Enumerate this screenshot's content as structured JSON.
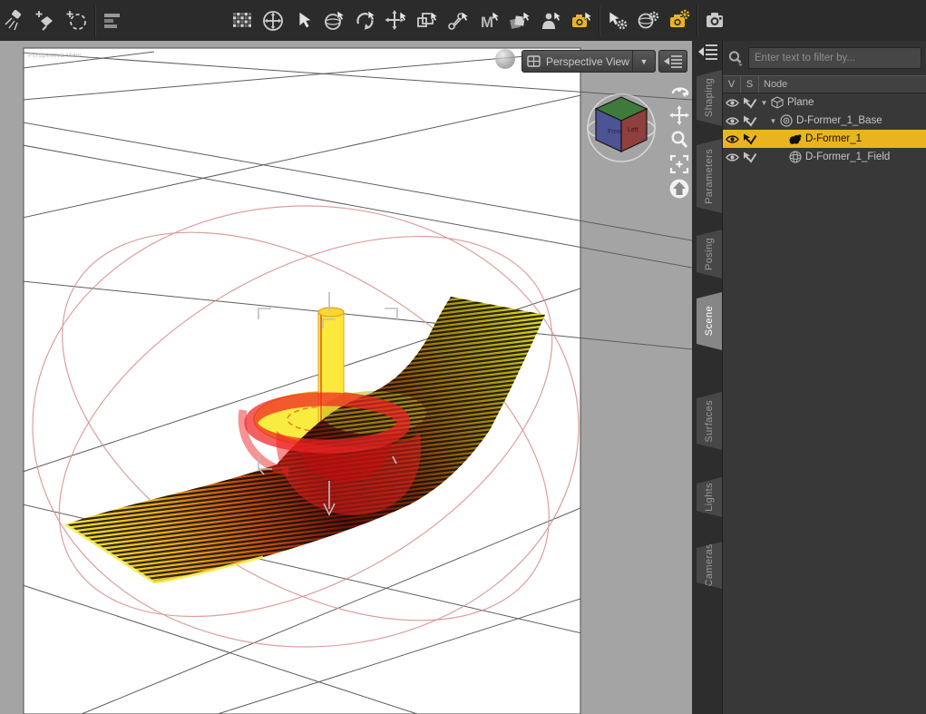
{
  "app": {
    "name": "3D scene editor viewport"
  },
  "toolbar": {
    "icons": [
      {
        "name": "spotlight-tool",
        "accent": false
      },
      {
        "name": "add-node-tool",
        "accent": false
      },
      {
        "name": "add-selection-tool",
        "accent": false
      },
      {
        "name": "scene-list-tool",
        "accent": false
      },
      {
        "name": "grid-snap-tool",
        "accent": false
      },
      {
        "name": "universal-manipulator-tool",
        "accent": false
      },
      {
        "name": "node-selection-tool",
        "accent": false
      },
      {
        "name": "orbit-selection-tool",
        "accent": false
      },
      {
        "name": "rotate-tool",
        "accent": false
      },
      {
        "name": "translate-tool",
        "accent": false
      },
      {
        "name": "scale-tool",
        "accent": false
      },
      {
        "name": "joint-editor-tool",
        "accent": false
      },
      {
        "name": "geometry-editor-tool",
        "accent": false
      },
      {
        "name": "surface-selection-tool",
        "accent": false
      },
      {
        "name": "figure-selection-tool",
        "accent": false
      },
      {
        "name": "camera-selection-tool",
        "accent": true
      },
      {
        "name": "pointer-settings-tool",
        "accent": false
      },
      {
        "name": "sphere-settings-tool",
        "accent": false
      },
      {
        "name": "camera-settings-tool",
        "accent": true
      },
      {
        "name": "render-camera-tool",
        "accent": false
      }
    ]
  },
  "viewport": {
    "corner_label": "Perspective View",
    "view_selector": {
      "label": "Perspective View",
      "arrow": "▼"
    },
    "nav_tools": [
      "orbit-icon",
      "pan-icon",
      "zoom-icon",
      "frame-icon",
      "home-icon"
    ],
    "view_cube": {
      "front_label": "Front",
      "left_label": "Left"
    }
  },
  "side_tabs": {
    "items": [
      {
        "label": "Shaping",
        "active": false
      },
      {
        "label": "Parameters",
        "active": false
      },
      {
        "label": "Posing",
        "active": false
      },
      {
        "label": "Scene",
        "active": true
      },
      {
        "label": "Surfaces",
        "active": false
      },
      {
        "label": "Lights",
        "active": false
      },
      {
        "label": "Cameras",
        "active": false
      }
    ]
  },
  "scene_panel": {
    "filter": {
      "placeholder": "Enter text to filter by...",
      "icon": "search-icon"
    },
    "columns": [
      "V",
      "S",
      "Node"
    ],
    "tree": [
      {
        "label": "Plane",
        "depth": 0,
        "expanded": true,
        "icon": "cube-icon",
        "selected": false
      },
      {
        "label": "D-Former_1_Base",
        "depth": 1,
        "expanded": true,
        "icon": "base-icon",
        "selected": false
      },
      {
        "label": "D-Former_1",
        "depth": 2,
        "expanded": null,
        "icon": "dformer-icon",
        "selected": true
      },
      {
        "label": "D-Former_1_Field",
        "depth": 2,
        "expanded": null,
        "icon": "field-icon",
        "selected": false
      }
    ]
  },
  "colors": {
    "selection_yellow": "#eab41e",
    "toolbar_accent": "#e8b427",
    "deformer_yellow": "#ffe83c",
    "field_red": "#e03030",
    "viewport_gray": "#a4a4a4"
  }
}
